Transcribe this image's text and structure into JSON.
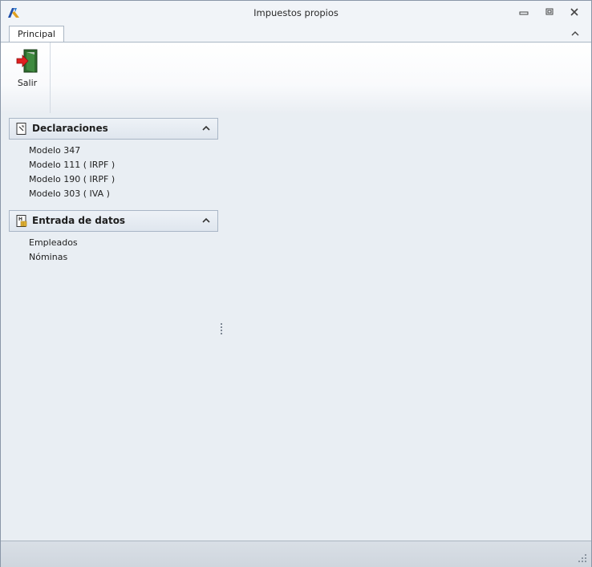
{
  "window": {
    "title": "Impuestos propios"
  },
  "ribbon": {
    "tabs": [
      {
        "label": "Principal",
        "active": true
      }
    ],
    "buttons": [
      {
        "label": "Salir",
        "icon": "exit-door-icon"
      }
    ]
  },
  "nav_groups": [
    {
      "title": "Declaraciones",
      "icon": "document-icon",
      "expanded": true,
      "items": [
        "Modelo 347",
        "Modelo 111 ( IRPF )",
        "Modelo 190 ( IRPF )",
        "Modelo 303 ( IVA )"
      ]
    },
    {
      "title": "Entrada de datos",
      "icon": "data-sheet-icon",
      "expanded": true,
      "items": [
        "Empleados",
        "Nóminas"
      ]
    }
  ],
  "colors": {
    "background": "#e9eef3",
    "header_border": "#a9b6c6",
    "exit_arrow": "#e02020",
    "door": "#2d6b2d"
  }
}
